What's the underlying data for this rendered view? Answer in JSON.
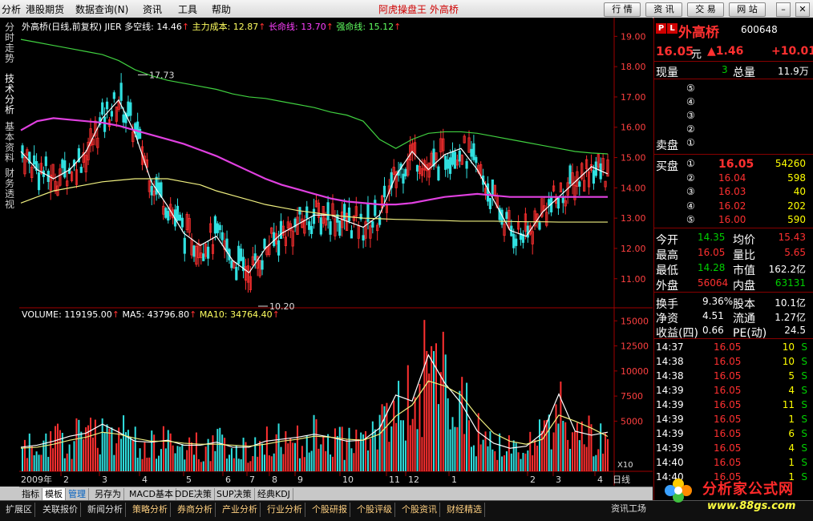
{
  "menu": {
    "items": [
      "分析",
      "港股期货",
      "数据查询(N)",
      "资讯",
      "工具",
      "帮助"
    ],
    "app_title": "阿虎操盘王  外高桥",
    "buttons": [
      "行 情",
      "资 讯",
      "交 易",
      "网 站"
    ]
  },
  "left_tabs": [
    "分时走势",
    "技术分析",
    "基本资料",
    "财务透视"
  ],
  "legend_main": {
    "name": "外高桥(日线,前复权) JIER",
    "items": [
      {
        "label": "多空线: 14.46",
        "color": "#ffffff"
      },
      {
        "label": "主力成本: 12.87",
        "color": "#ffff60"
      },
      {
        "label": "长命线: 13.70",
        "color": "#ff40ff"
      },
      {
        "label": "强命线: 15.12",
        "color": "#60ff60"
      }
    ]
  },
  "legend_vol": {
    "items": [
      {
        "label": "VOLUME: 119195.00",
        "color": "#ffffff"
      },
      {
        "label": "MA5: 43796.80",
        "color": "#ffffff"
      },
      {
        "label": "MA10: 34764.40",
        "color": "#ffff60"
      }
    ]
  },
  "bottom_tabs_row1": [
    "指标",
    "模板",
    "管理",
    "另存为",
    "MACD基本",
    "DDE决策",
    "SUP决策",
    "经典KDJ"
  ],
  "bottom_tabs_row2": [
    "扩展区",
    "关联报价",
    "新闻分析",
    "策略分析",
    "券商分析",
    "产业分析",
    "行业分析",
    "个股研报",
    "个股评级",
    "个股资讯",
    "财经精选"
  ],
  "day_label": "日线",
  "corner_label": "",
  "info_button": "资讯工场",
  "watermark": {
    "text": "分析家公式网",
    "url": "www.88gs.com"
  },
  "chart_data": {
    "type": "candlestick",
    "price_axis": {
      "ticks": [
        19.0,
        18.0,
        17.0,
        16.0,
        15.0,
        14.0,
        13.0,
        12.0,
        11.0
      ],
      "range": [
        10.2,
        19.3
      ]
    },
    "volume_axis": {
      "ticks": [
        15000,
        12500,
        10000,
        7500,
        5000
      ],
      "range": [
        0,
        15500
      ]
    },
    "x_ticks": [
      "2009年",
      "2",
      "3",
      "4",
      "5",
      "6",
      "7",
      "8",
      "9",
      "10",
      "11",
      "12",
      "1",
      "2",
      "3",
      "4"
    ],
    "annotations": [
      {
        "label": "17.73",
        "price": 17.73
      },
      {
        "label": "10.20",
        "price": 10.2
      }
    ],
    "volume_unit": "X10",
    "ma_curves": {
      "多空线": [
        15.2,
        14.6,
        14.3,
        14.6,
        15.2,
        16.3,
        16.9,
        15.8,
        14.2,
        13.4,
        12.5,
        12.1,
        12.4,
        11.6,
        11.2,
        12.0,
        12.5,
        12.8,
        13.1,
        13.1,
        12.9,
        12.7,
        13.1,
        14.4,
        15.2,
        14.6,
        15.1,
        15.3,
        14.6,
        13.6,
        12.6,
        12.4,
        13.2,
        13.7,
        14.2,
        14.7,
        14.46
      ],
      "主力成本": [
        13.5,
        13.7,
        13.9,
        14.0,
        14.1,
        14.2,
        14.25,
        14.3,
        14.3,
        14.3,
        14.2,
        14.1,
        13.9,
        13.75,
        13.6,
        13.45,
        13.35,
        13.25,
        13.18,
        13.1,
        13.05,
        13.0,
        12.98,
        12.96,
        12.95,
        12.93,
        12.92,
        12.9,
        12.9,
        12.9,
        12.89,
        12.88,
        12.88,
        12.87,
        12.87,
        12.87,
        12.87
      ],
      "长命线": [
        15.9,
        16.2,
        16.3,
        16.25,
        16.2,
        16.15,
        16.05,
        15.9,
        15.75,
        15.6,
        15.45,
        15.25,
        15.05,
        14.8,
        14.55,
        14.3,
        14.1,
        13.95,
        13.8,
        13.65,
        13.55,
        13.5,
        13.45,
        13.45,
        13.5,
        13.6,
        13.7,
        13.75,
        13.8,
        13.75,
        13.7,
        13.7,
        13.7,
        13.7,
        13.7,
        13.7,
        13.7
      ],
      "强命线": [
        18.9,
        18.8,
        18.7,
        18.6,
        18.5,
        18.4,
        18.2,
        17.9,
        17.7,
        17.55,
        17.45,
        17.35,
        17.25,
        17.1,
        17.0,
        16.95,
        16.85,
        16.75,
        16.65,
        16.5,
        16.4,
        16.2,
        15.6,
        15.3,
        15.6,
        15.8,
        15.85,
        15.85,
        15.8,
        15.7,
        15.6,
        15.5,
        15.4,
        15.3,
        15.2,
        15.15,
        15.12
      ]
    },
    "volume_ma5": [
      2400,
      2600,
      3000,
      3500,
      3800,
      4700,
      3900,
      3000,
      2900,
      3100,
      2600,
      2600,
      2900,
      2400,
      2400,
      3000,
      3200,
      3400,
      3700,
      3400,
      3000,
      3100,
      4300,
      7600,
      7000,
      11600,
      8800,
      6800,
      4000,
      2800,
      2300,
      2500,
      3800,
      7700,
      4000,
      3600,
      3900
    ],
    "volume_ma10": [
      2300,
      2400,
      2700,
      3100,
      3400,
      3900,
      3700,
      3300,
      3000,
      3000,
      2800,
      2700,
      2700,
      2600,
      2500,
      2700,
      3000,
      3200,
      3500,
      3400,
      3200,
      3100,
      3700,
      5500,
      6600,
      9000,
      8500,
      7600,
      5500,
      3800,
      3000,
      2700,
      3200,
      5600,
      5000,
      4300,
      3476
    ]
  },
  "panel": {
    "pl_left": "P",
    "pl_right": "L",
    "name": "外高桥",
    "code": "600648",
    "price": "16.05",
    "price_unit": "元",
    "change": "▲1.46",
    "change_pct": "+10.01",
    "now_vol_label": "现量",
    "now_vol": "3",
    "total_vol_label": "总量",
    "total_vol": "11.9万",
    "sell_label": "卖盘",
    "sell_rows": [
      {
        "n": "⑤",
        "p": "",
        "v": ""
      },
      {
        "n": "④",
        "p": "",
        "v": ""
      },
      {
        "n": "③",
        "p": "",
        "v": ""
      },
      {
        "n": "②",
        "p": "",
        "v": ""
      },
      {
        "n": "①",
        "p": "",
        "v": ""
      }
    ],
    "buy_label": "买盘",
    "buy_rows": [
      {
        "n": "①",
        "p": "16.05",
        "v": "54260"
      },
      {
        "n": "②",
        "p": "16.04",
        "v": "598"
      },
      {
        "n": "③",
        "p": "16.03",
        "v": "40"
      },
      {
        "n": "④",
        "p": "16.02",
        "v": "202"
      },
      {
        "n": "⑤",
        "p": "16.00",
        "v": "590"
      }
    ],
    "stats": [
      {
        "l1": "今开",
        "v1": "14.35",
        "c1": "grn",
        "l2": "均价",
        "v2": "15.43",
        "c2": "red"
      },
      {
        "l1": "最高",
        "v1": "16.05",
        "c1": "red",
        "l2": "量比",
        "v2": "5.65",
        "c2": "red"
      },
      {
        "l1": "最低",
        "v1": "14.28",
        "c1": "grn",
        "l2": "市值",
        "v2": "162.2亿",
        "c2": "wht"
      },
      {
        "l1": "外盘",
        "v1": "56064",
        "c1": "red",
        "l2": "内盘",
        "v2": "63131",
        "c2": "grn"
      }
    ],
    "stats2": [
      {
        "l1": "换手",
        "v1": "9.36%",
        "l2": "股本",
        "v2": "10.1亿"
      },
      {
        "l1": "净资",
        "v1": "4.51",
        "l2": "流通",
        "v2": "1.27亿"
      },
      {
        "l1": "收益(四)",
        "v1": "0.66",
        "l2": "PE(动)",
        "v2": "24.5"
      }
    ],
    "ticks": [
      {
        "t": "14:37",
        "p": "16.05",
        "v": "10",
        "s": "S"
      },
      {
        "t": "14:38",
        "p": "16.05",
        "v": "10",
        "s": "S"
      },
      {
        "t": "14:38",
        "p": "16.05",
        "v": "5",
        "s": "S"
      },
      {
        "t": "14:39",
        "p": "16.05",
        "v": "4",
        "s": "S"
      },
      {
        "t": "14:39",
        "p": "16.05",
        "v": "11",
        "s": "S"
      },
      {
        "t": "14:39",
        "p": "16.05",
        "v": "1",
        "s": "S"
      },
      {
        "t": "14:39",
        "p": "16.05",
        "v": "6",
        "s": "S"
      },
      {
        "t": "14:39",
        "p": "16.05",
        "v": "4",
        "s": "S"
      },
      {
        "t": "14:40",
        "p": "16.05",
        "v": "1",
        "s": "S"
      },
      {
        "t": "14:40",
        "p": "16.05",
        "v": "1",
        "s": "S"
      }
    ]
  }
}
